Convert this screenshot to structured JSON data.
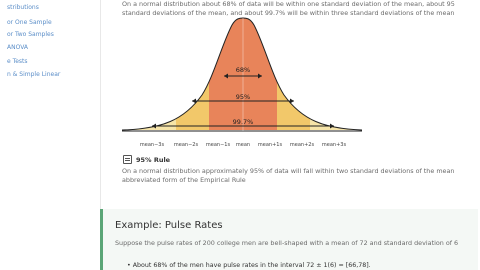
{
  "sidebar": {
    "items": [
      {
        "label": "stributions"
      },
      {
        "label": "or One Sample"
      },
      {
        "label": "or Two Samples"
      },
      {
        "label": "ANOVA"
      },
      {
        "label": "e Tests"
      },
      {
        "label": "n & Simple Linear"
      }
    ]
  },
  "para1": {
    "line1": "On a normal distribution about 68% of data will be within one standard deviation of the mean, about 95",
    "line2": "standard deviations of the mean, and about 99.7% will be within three standard deviations of the mean"
  },
  "figure": {
    "labels": [
      "68%",
      "95%",
      "99.7%"
    ],
    "ticks": [
      "mean−3s",
      "mean−2s",
      "mean−1s",
      "mean",
      "mean+1s",
      "mean+2s",
      "mean+3s"
    ]
  },
  "rule": {
    "title": "95% Rule",
    "line1": "On a normal distribution approximately 95% of data will fall within two standard deviations of the mean",
    "line2": "abbreviated form of the Empirical Rule"
  },
  "example": {
    "title": "Example: Pulse Rates",
    "text": "Suppose the pulse rates of 200 college men are bell-shaped with a mean of 72 and standard deviation of 6",
    "bullet": "About 68% of the men have pulse rates in the interval 72 ± 1(6) = [66,78]."
  },
  "colors": {
    "center": "#e8845a",
    "mid": "#f2c86a",
    "tail": "#f6e4a8",
    "accent": "#5aa576"
  }
}
